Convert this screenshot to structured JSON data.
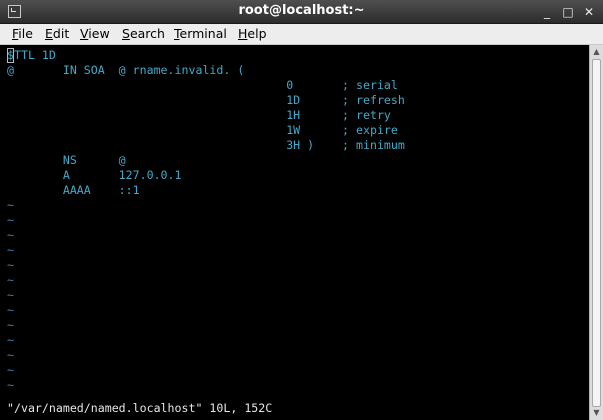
{
  "window": {
    "title": "root@localhost:~",
    "minimize_glyph": "_",
    "maximize_glyph": "□",
    "close_glyph": "✕"
  },
  "menu": [
    {
      "accel": "F",
      "rest": "ile"
    },
    {
      "accel": "E",
      "rest": "dit"
    },
    {
      "accel": "V",
      "rest": "iew"
    },
    {
      "accel": "S",
      "rest": "earch"
    },
    {
      "accel": "T",
      "rest": "erminal"
    },
    {
      "accel": "H",
      "rest": "elp"
    }
  ],
  "editor": {
    "lines": [
      "$TTL 1D",
      "@       IN SOA  @ rname.invalid. (",
      "                                        0       ; serial",
      "                                        1D      ; refresh",
      "                                        1H      ; retry",
      "                                        1W      ; expire",
      "                                        3H )    ; minimum",
      "        NS      @",
      "        A       127.0.0.1",
      "        AAAA    ::1"
    ],
    "tilde": "~",
    "status_line": "\"/var/named/named.localhost\" 10L, 152C"
  },
  "colors": {
    "text": "#44a8c8",
    "tilde": "#3b82b4",
    "background": "#000000"
  }
}
